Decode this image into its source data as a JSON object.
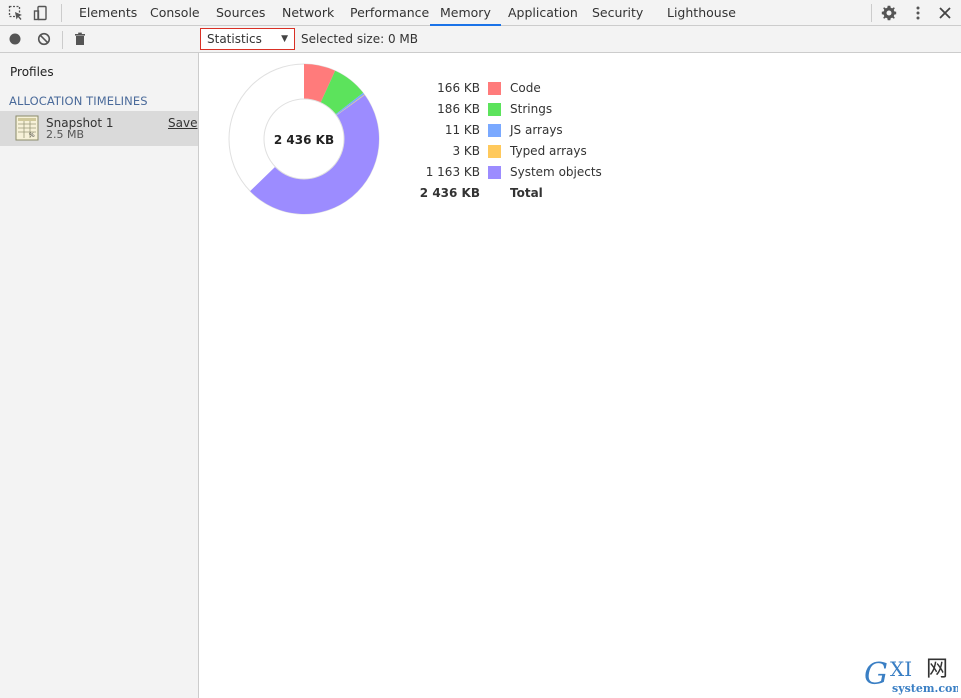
{
  "tabs": [
    {
      "label": "Elements"
    },
    {
      "label": "Console"
    },
    {
      "label": "Sources"
    },
    {
      "label": "Network"
    },
    {
      "label": "Performance"
    },
    {
      "label": "Memory"
    },
    {
      "label": "Application"
    },
    {
      "label": "Security"
    },
    {
      "label": "Lighthouse"
    }
  ],
  "active_tab": "Memory",
  "toolbar": {
    "view_select_value": "Statistics",
    "selected_size": "Selected size: 0 MB"
  },
  "sidebar": {
    "title": "Profiles",
    "section": "ALLOCATION TIMELINES",
    "snapshot": {
      "name": "Snapshot 1",
      "size": "2.5 MB",
      "save_label": "Save"
    }
  },
  "stats": {
    "total_center": "2 436 KB",
    "items": [
      {
        "value": "166 KB",
        "label": "Code",
        "color": "#ff7b7b"
      },
      {
        "value": "186 KB",
        "label": "Strings",
        "color": "#5ce35c"
      },
      {
        "value": "11 KB",
        "label": "JS arrays",
        "color": "#7aa9ff"
      },
      {
        "value": "3 KB",
        "label": "Typed arrays",
        "color": "#ffc95c"
      },
      {
        "value": "1 163 KB",
        "label": "System objects",
        "color": "#9c8cff"
      }
    ],
    "total": {
      "value": "2 436 KB",
      "label": "Total"
    }
  },
  "colors": {
    "accent": "#1a73e8",
    "select_border": "#d93025"
  },
  "watermark": {
    "brand": "GXI网",
    "site": "system.com"
  }
}
